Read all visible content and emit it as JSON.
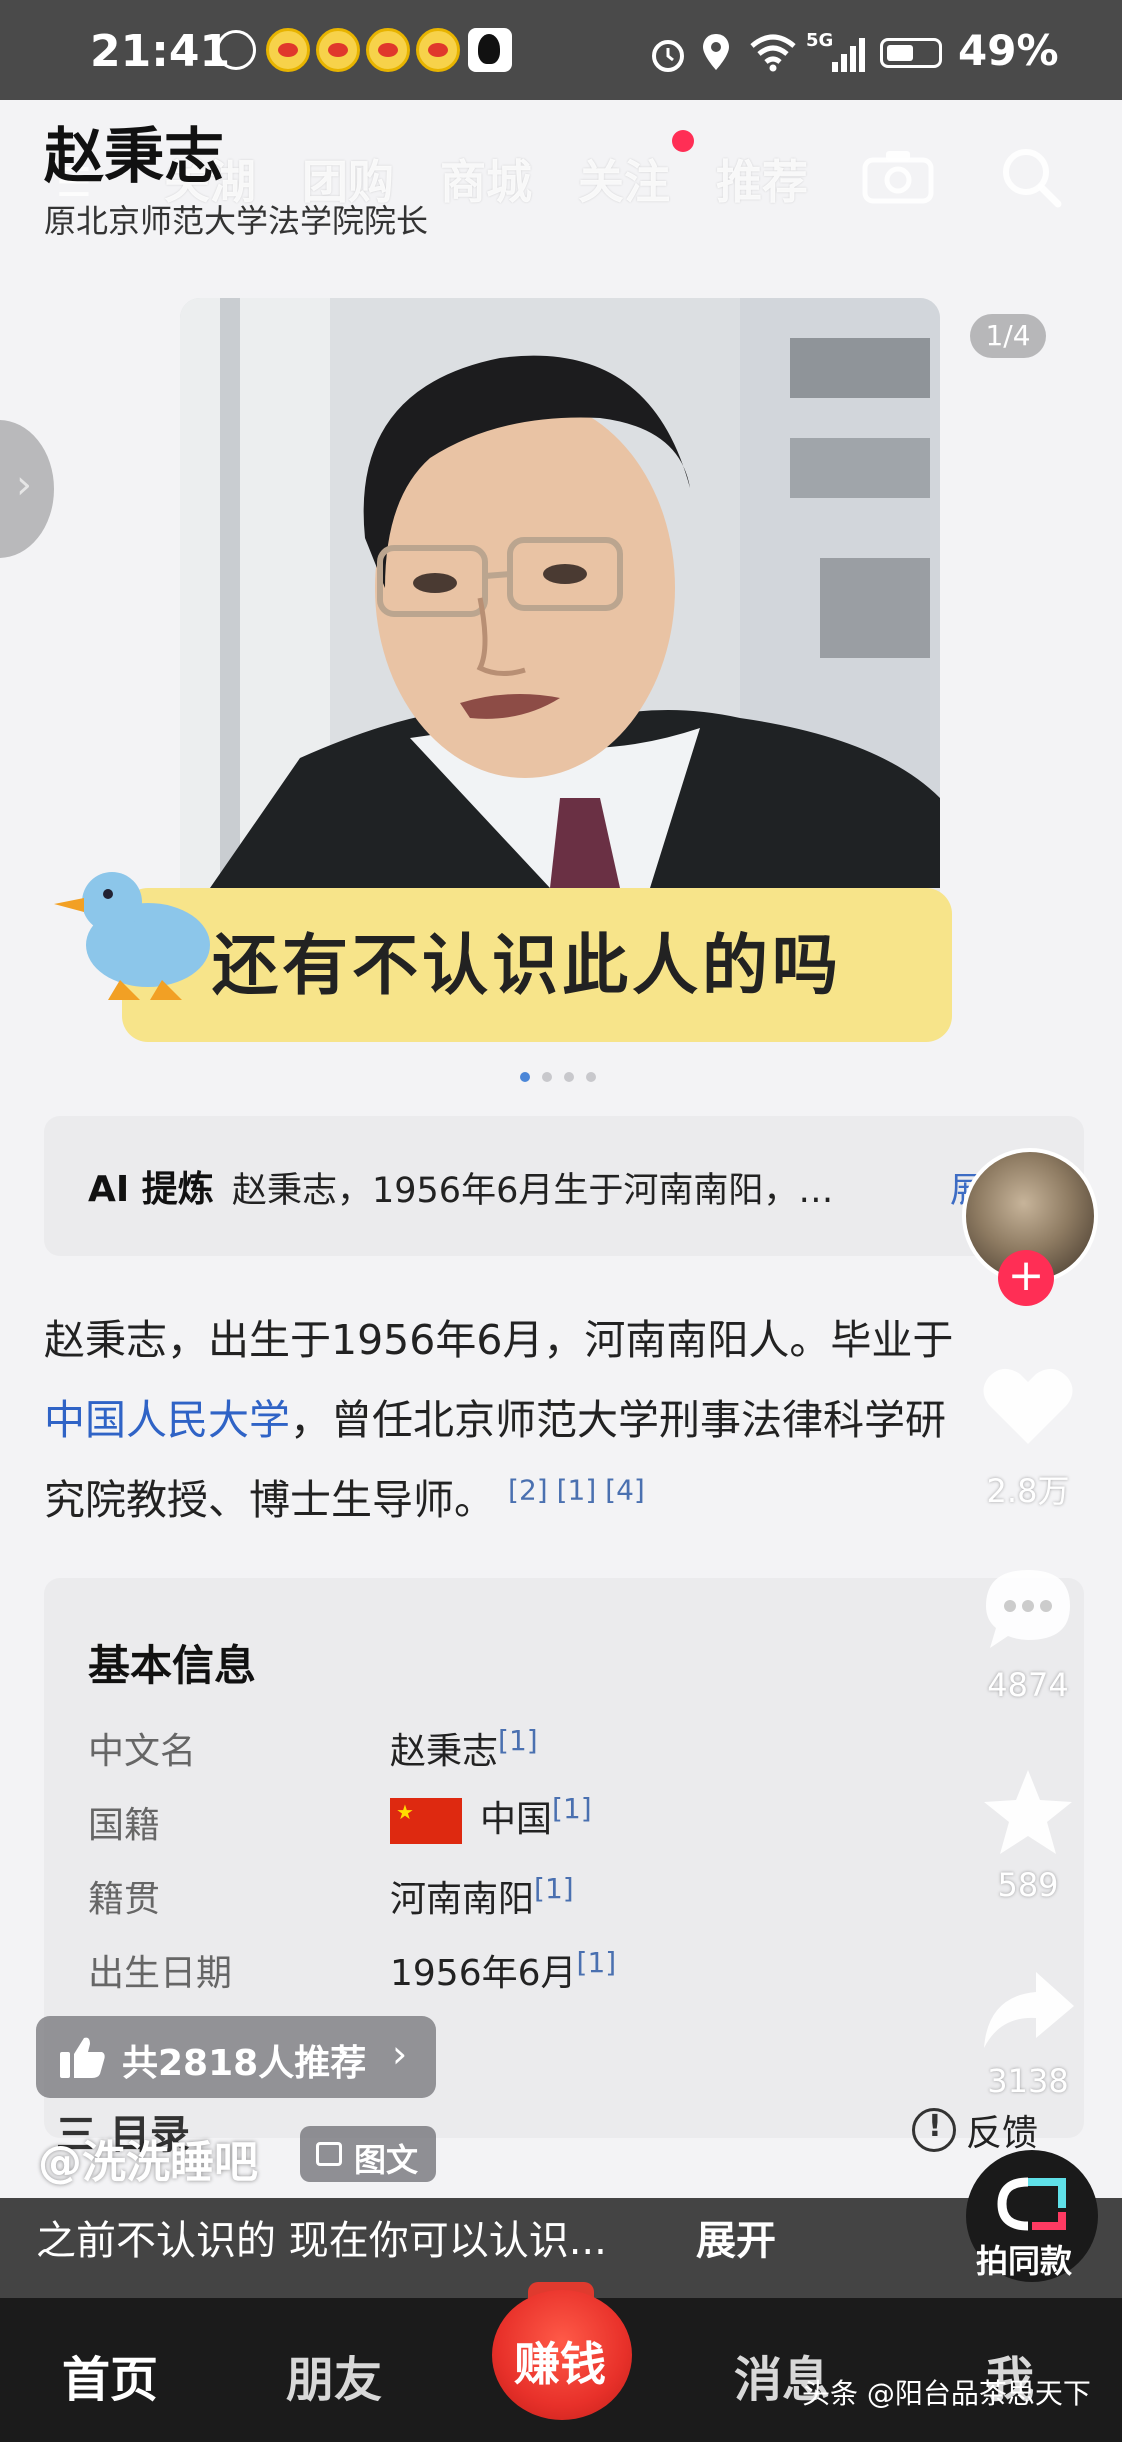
{
  "status_bar": {
    "time": "21:41",
    "network": "5G",
    "battery": "49%"
  },
  "header": {
    "person_name": "赵秉志",
    "person_title": "原北京师范大学法学院院长",
    "overlay_tabs": [
      "关湖",
      "团购",
      "商城",
      "关注",
      "推荐"
    ]
  },
  "carousel": {
    "counter": "1/4",
    "banner_text": "还有不认识此人的吗",
    "page_count": 4,
    "active_index": 0
  },
  "ai_summary": {
    "label": "AI 提炼",
    "text": "赵秉志，1956年6月生于河南南阳，…",
    "more": "展"
  },
  "bio": {
    "line1": "赵秉志，出生于1956年6月，河南南阳人。毕业于",
    "line2_link": "中国人民大学",
    "line2_rest": "，曾任北京师范大学刑事法律科学研",
    "line3": "究院教授、博士生导师。",
    "refs": "[2] [1] [4]"
  },
  "info": {
    "heading": "基本信息",
    "rows": [
      {
        "label": "中文名",
        "value": "赵秉志",
        "ref": "[1]"
      },
      {
        "label": "国籍",
        "value": "中国",
        "ref": "[1]"
      },
      {
        "label": "籍贯",
        "value": "河南南阳",
        "ref": "[1]"
      },
      {
        "label": "出生日期",
        "value": "1956年6月",
        "ref": "[1]"
      }
    ],
    "toc_label": "三 目录"
  },
  "overlay": {
    "recommend": "共2818人推荐",
    "author": "@洗洗睡吧",
    "tag": "图文",
    "caption": "之前不认识的   现在你可以认识...",
    "expand": "展开",
    "feedback": "反馈"
  },
  "rail": {
    "likes": "2.8万",
    "comments": "4874",
    "favorites": "589",
    "shares": "3138",
    "remix": "拍同款"
  },
  "nav": {
    "home": "首页",
    "friends": "朋友",
    "earn": "赚钱",
    "messages": "消息",
    "me": "我"
  },
  "watermark": "头条 @阳台品茶思天下",
  "colors": {
    "accent_red": "#ff2e55",
    "link_blue": "#2f63c6",
    "banner_yellow": "#f7e48a"
  }
}
